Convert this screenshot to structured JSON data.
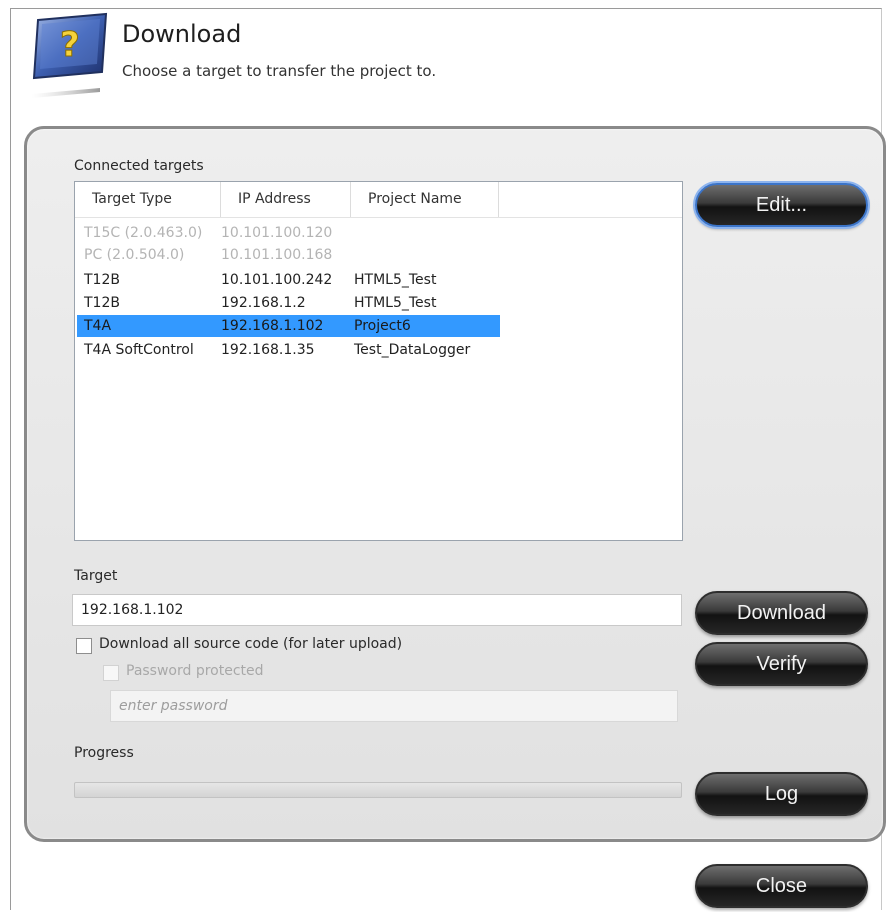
{
  "dialog": {
    "title": "Download",
    "subtitle": "Choose a target to transfer the project to.",
    "icon": "download-help-icon"
  },
  "connected_targets": {
    "label": "Connected targets",
    "columns": [
      "Target Type",
      "IP Address",
      "Project Name"
    ],
    "rows": [
      {
        "type": "T15C (2.0.463.0)",
        "ip": "10.101.100.120",
        "project": "",
        "state": "disabled"
      },
      {
        "type": "PC (2.0.504.0)",
        "ip": "10.101.100.168",
        "project": "",
        "state": "disabled"
      },
      {
        "type": "T12B",
        "ip": "10.101.100.242",
        "project": "HTML5_Test",
        "state": "normal"
      },
      {
        "type": "T12B",
        "ip": "192.168.1.2",
        "project": "HTML5_Test",
        "state": "normal"
      },
      {
        "type": "T4A",
        "ip": "192.168.1.102",
        "project": "Project6",
        "state": "selected"
      },
      {
        "type": "T4A SoftControl",
        "ip": "192.168.1.35",
        "project": "Test_DataLogger",
        "state": "normal"
      }
    ]
  },
  "buttons": {
    "edit": "Edit...",
    "download": "Download",
    "verify": "Verify",
    "log": "Log",
    "close": "Close"
  },
  "target": {
    "label": "Target",
    "value": "192.168.1.102"
  },
  "options": {
    "download_source_label": "Download all source code (for later upload)",
    "download_source_checked": false,
    "password_protected_label": "Password protected",
    "password_protected_checked": false,
    "password_placeholder": "enter password"
  },
  "progress": {
    "label": "Progress",
    "value": 0
  },
  "colors": {
    "selection": "#3399ff",
    "accent_border": "#3b74c8"
  }
}
